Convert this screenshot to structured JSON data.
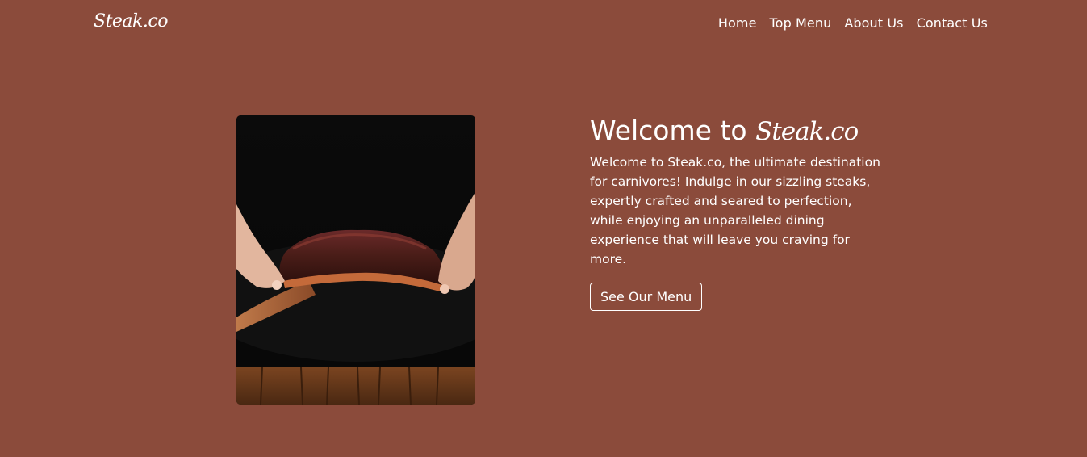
{
  "header": {
    "brand": "Steak.co",
    "nav": [
      "Home",
      "Top Menu",
      "About Us",
      "Contact Us"
    ]
  },
  "hero": {
    "title_prefix": "Welcome to ",
    "title_brand": "Steak.co",
    "description": "Welcome to Steak.co, the ultimate destination for carnivores! Indulge in our sizzling steaks, expertly crafted and seared to perfection, while enjoying an unparalleled dining experience that will leave you craving for more.",
    "button_label": "See Our Menu",
    "image": "steak-photo"
  },
  "colors": {
    "background": "#8b4b3b",
    "text": "#ffffff",
    "button_border": "#ffffff"
  }
}
